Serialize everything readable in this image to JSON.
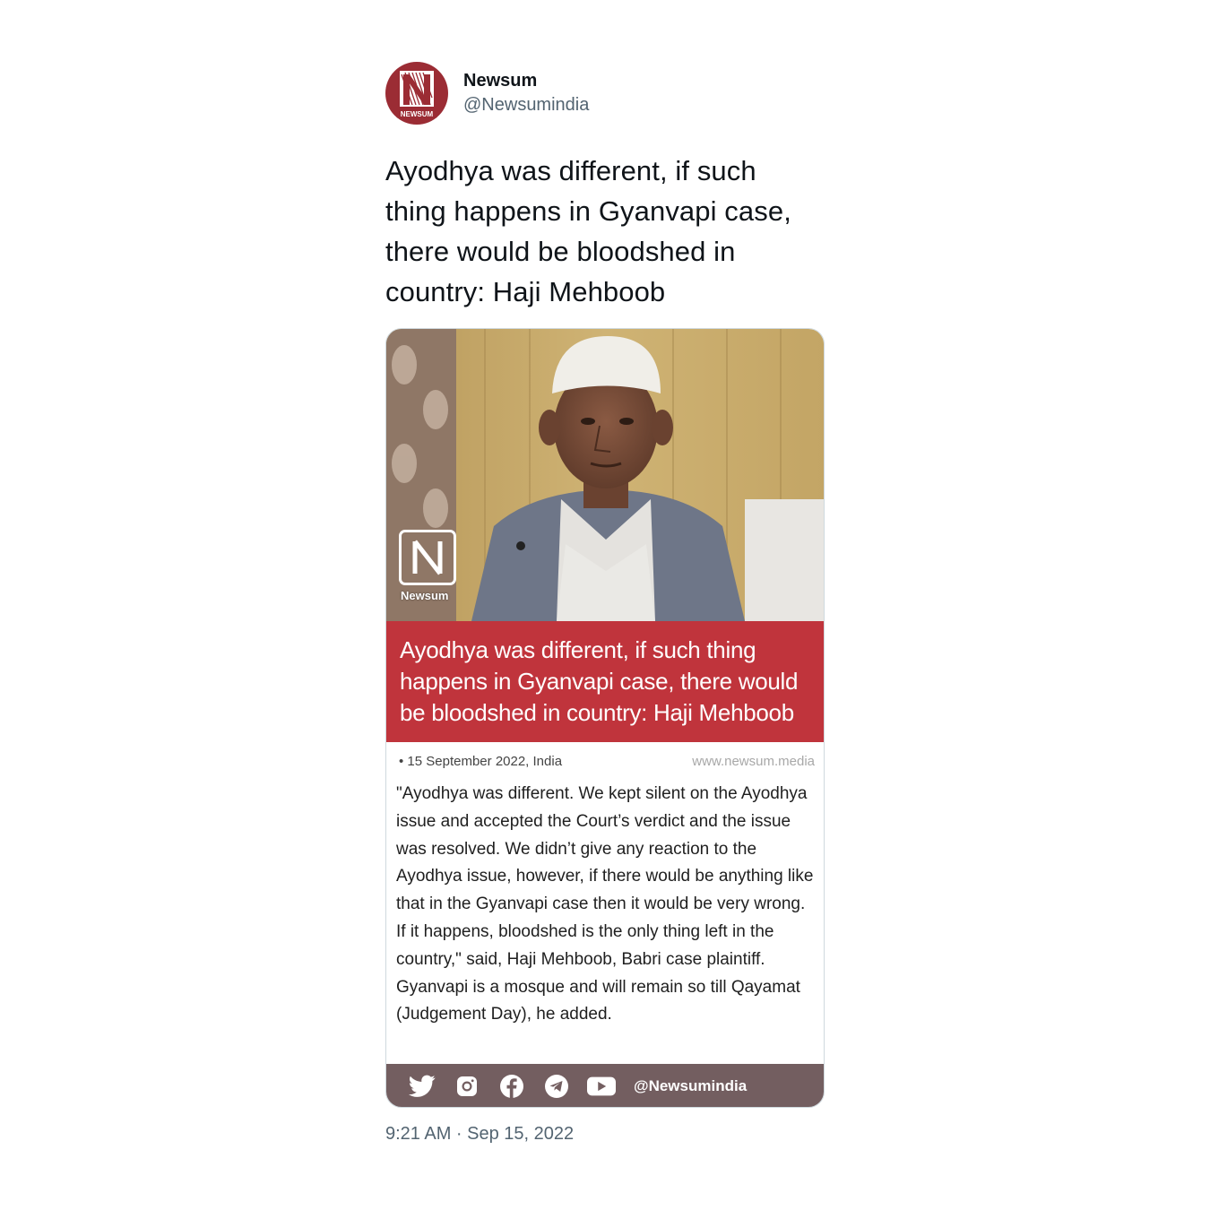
{
  "author": {
    "display_name": "Newsum",
    "handle": "@Newsumindia",
    "avatar_label": "NEWSUM"
  },
  "tweet": {
    "text": "Ayodhya was different, if such thing happens in Gyanvapi case, there would be bloodshed in country: Haji Mehboob",
    "timestamp": "9:21 AM · Sep 15, 2022"
  },
  "card": {
    "watermark_label": "Newsum",
    "headline": "Ayodhya was different, if such thing happens in Gyanvapi case, there would be bloodshed in country: Haji Mehboob",
    "date_line": "• 15 September 2022, India",
    "site": "www.newsum.media",
    "body": "\"Ayodhya was different. We kept silent on the Ayodhya issue and accepted the Court’s verdict and the issue was resolved. We didn’t give any reaction to the Ayodhya issue, however, if there would be anything like that in the Gyanvapi case then it would be very wrong. If it happens, bloodshed is the only thing left in the country,\" said, Haji Mehboob, Babri case plaintiff. Gyanvapi is a mosque and will remain so till Qayamat (Judgement Day), he added.",
    "footer_handle": "@Newsumindia",
    "social_icons": [
      "twitter-icon",
      "instagram-icon",
      "facebook-icon",
      "telegram-icon",
      "youtube-icon"
    ]
  },
  "colors": {
    "brand_red": "#c0343c",
    "avatar_red": "#9b2c34",
    "footer_bg": "#735e60",
    "handle_gray": "#536471"
  }
}
